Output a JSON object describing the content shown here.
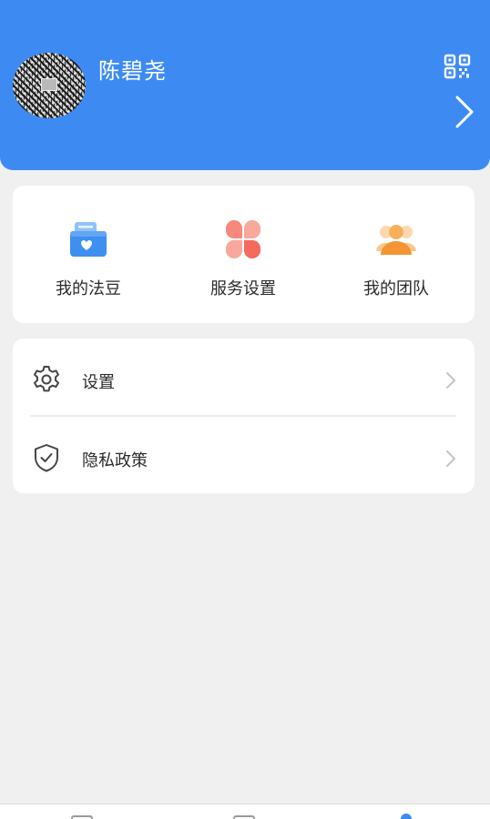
{
  "profile": {
    "name": "陈碧尧",
    "qr_icon": "qr-code-icon",
    "arrow_icon": "chevron-right-icon"
  },
  "quick_actions": [
    {
      "label": "我的法豆",
      "icon": "folder-heart-icon",
      "color": "#4f9df5"
    },
    {
      "label": "服务设置",
      "icon": "petals-grid-icon",
      "color": "#f5776a"
    },
    {
      "label": "我的团队",
      "icon": "team-person-icon",
      "color": "#f39b3e"
    }
  ],
  "menu": [
    {
      "label": "设置",
      "icon": "gear-icon"
    },
    {
      "label": "隐私政策",
      "icon": "shield-check-icon"
    }
  ],
  "colors": {
    "header_bg": "#3d8bf2",
    "page_bg": "#f0f0f0",
    "card_bg": "#ffffff",
    "text": "#2a2a2a"
  },
  "tabbar": {
    "active_index": 2
  }
}
